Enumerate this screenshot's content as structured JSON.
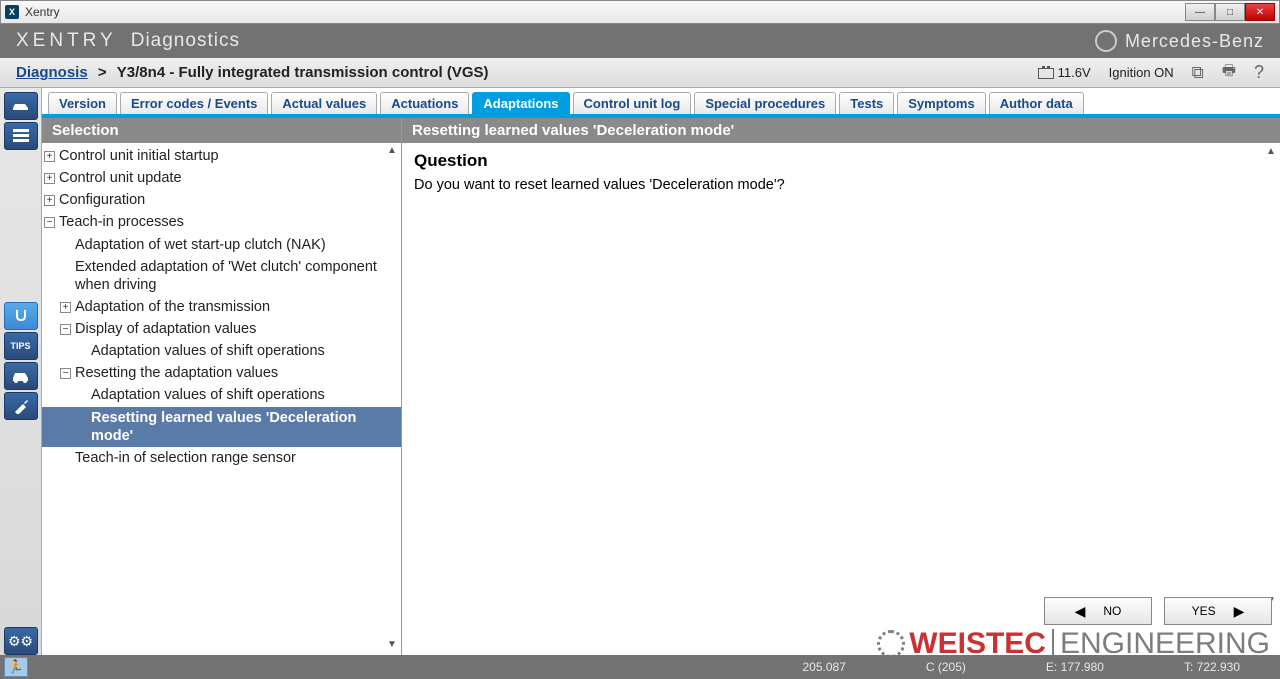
{
  "window": {
    "title": "Xentry"
  },
  "header": {
    "brand": "XENTRY",
    "sub": "Diagnostics",
    "mb": "Mercedes-Benz"
  },
  "breadcrumb": {
    "link": "Diagnosis",
    "current": "Y3/8n4 - Fully integrated transmission control (VGS)"
  },
  "statusTop": {
    "voltage": "11.6V",
    "ignition": "Ignition ON"
  },
  "tabs": [
    {
      "label": "Version"
    },
    {
      "label": "Error codes / Events"
    },
    {
      "label": "Actual values"
    },
    {
      "label": "Actuations"
    },
    {
      "label": "Adaptations",
      "active": true
    },
    {
      "label": "Control unit log"
    },
    {
      "label": "Special procedures"
    },
    {
      "label": "Tests"
    },
    {
      "label": "Symptoms"
    },
    {
      "label": "Author data"
    }
  ],
  "leftHeader": "Selection",
  "rightHeader": "Resetting learned values 'Deceleration mode'",
  "tree": [
    {
      "label": "Control unit initial startup",
      "exp": "+",
      "indent": 0
    },
    {
      "label": "Control unit update",
      "exp": "+",
      "indent": 0
    },
    {
      "label": "Configuration",
      "exp": "+",
      "indent": 0
    },
    {
      "label": "Teach-in processes",
      "exp": "−",
      "indent": 0
    },
    {
      "label": "Adaptation of wet start-up clutch (NAK)",
      "exp": "",
      "indent": 1
    },
    {
      "label": "Extended adaptation of 'Wet clutch' component when driving",
      "exp": "",
      "indent": 1
    },
    {
      "label": "Adaptation of the transmission",
      "exp": "+",
      "indent": 1
    },
    {
      "label": "Display of adaptation values",
      "exp": "−",
      "indent": 1
    },
    {
      "label": "Adaptation values of shift operations",
      "exp": "",
      "indent": 2
    },
    {
      "label": "Resetting the adaptation values",
      "exp": "−",
      "indent": 1
    },
    {
      "label": "Adaptation values of shift operations",
      "exp": "",
      "indent": 2
    },
    {
      "label": "Resetting learned values 'Deceleration mode'",
      "exp": "",
      "indent": 2,
      "selected": true
    },
    {
      "label": "Teach-in of selection range sensor",
      "exp": "",
      "indent": 1
    }
  ],
  "question": {
    "heading": "Question",
    "text": "Do you want to reset learned values 'Deceleration mode'?"
  },
  "actions": {
    "no": "NO",
    "yes": "YES"
  },
  "statusBar": {
    "a": "205.087",
    "b": "C (205)",
    "c": "E: 177.980",
    "d": "T: 722.930"
  },
  "watermark": {
    "a": "WEISTEC",
    "b": "ENGINEERING"
  }
}
